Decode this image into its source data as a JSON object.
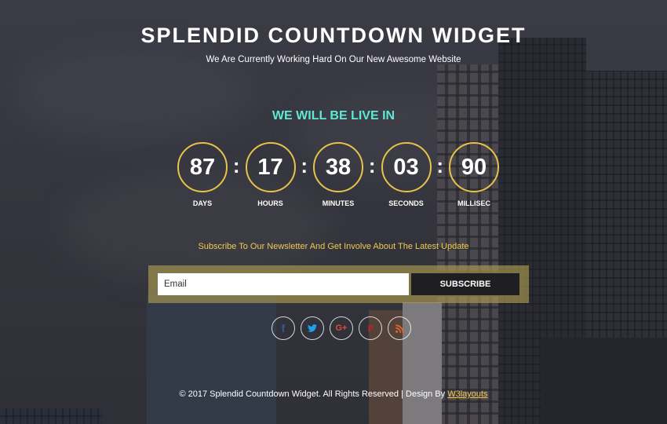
{
  "header": {
    "title": "SPLENDID COUNTDOWN WIDGET",
    "subtitle": "We Are Currently Working Hard On Our New Awesome Website"
  },
  "countdown": {
    "heading": "WE WILL BE LIVE IN",
    "separator": ":",
    "units": [
      {
        "value": "87",
        "label": "DAYS"
      },
      {
        "value": "17",
        "label": "HOURS"
      },
      {
        "value": "38",
        "label": "MINUTES"
      },
      {
        "value": "03",
        "label": "SECONDS"
      },
      {
        "value": "90",
        "label": "MILLISEC"
      }
    ]
  },
  "newsletter": {
    "text": "Subscribe To Our Newsletter And Get Involve About The Latest Update",
    "email_placeholder": "Email",
    "subscribe_label": "SUBSCRIBE"
  },
  "social": [
    {
      "icon": "facebook-icon",
      "glyph": "f",
      "color": "#3b5998"
    },
    {
      "icon": "twitter-icon",
      "glyph": "",
      "color": "#1da1f2"
    },
    {
      "icon": "google-plus-icon",
      "glyph": "G+",
      "color": "#dd4b39"
    },
    {
      "icon": "pinterest-icon",
      "glyph": "P",
      "color": "#cb2027"
    },
    {
      "icon": "rss-icon",
      "glyph": "",
      "color": "#f26522"
    }
  ],
  "footer": {
    "text": "© 2017 Splendid Countdown Widget. All Rights Reserved | Design By",
    "link_text": "W3layouts"
  },
  "colors": {
    "accent_teal": "#5ee8d5",
    "accent_gold": "#e7c34a",
    "newsletter_gold": "#f2c94c"
  }
}
